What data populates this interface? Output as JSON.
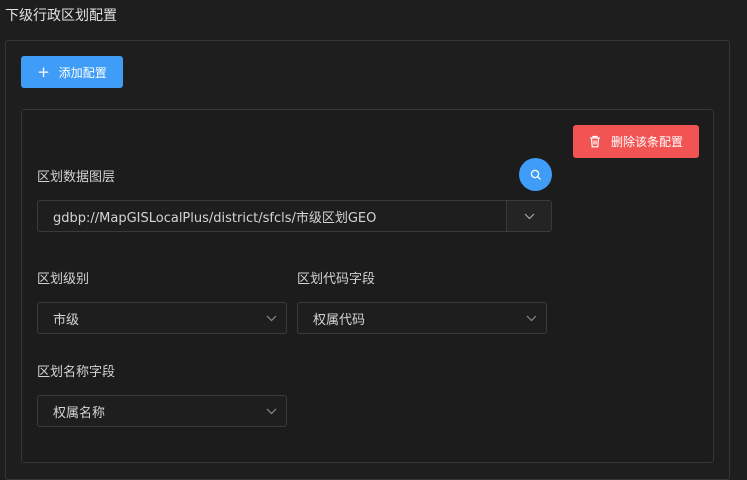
{
  "section": {
    "title": "下级行政区划配置"
  },
  "toolbar": {
    "add_label": "添加配置",
    "add_icon": "plus-icon"
  },
  "config_item": {
    "delete_label": "删除该条配置",
    "delete_icon": "trash-icon",
    "layer": {
      "label": "区划数据图层",
      "value": "gdbp://MapGISLocalPlus/district/sfcls/市级区划GEO",
      "search_icon": "search-icon",
      "dropdown_icon": "chevron-down-icon"
    },
    "level": {
      "label": "区划级别",
      "value": "市级"
    },
    "code_field": {
      "label": "区划代码字段",
      "value": "权属代码"
    },
    "name_field": {
      "label": "区划名称字段",
      "value": "权属名称"
    }
  },
  "colors": {
    "primary": "#3f9cf7",
    "danger": "#f25454",
    "background": "#1e1e1e",
    "border": "#363636"
  }
}
